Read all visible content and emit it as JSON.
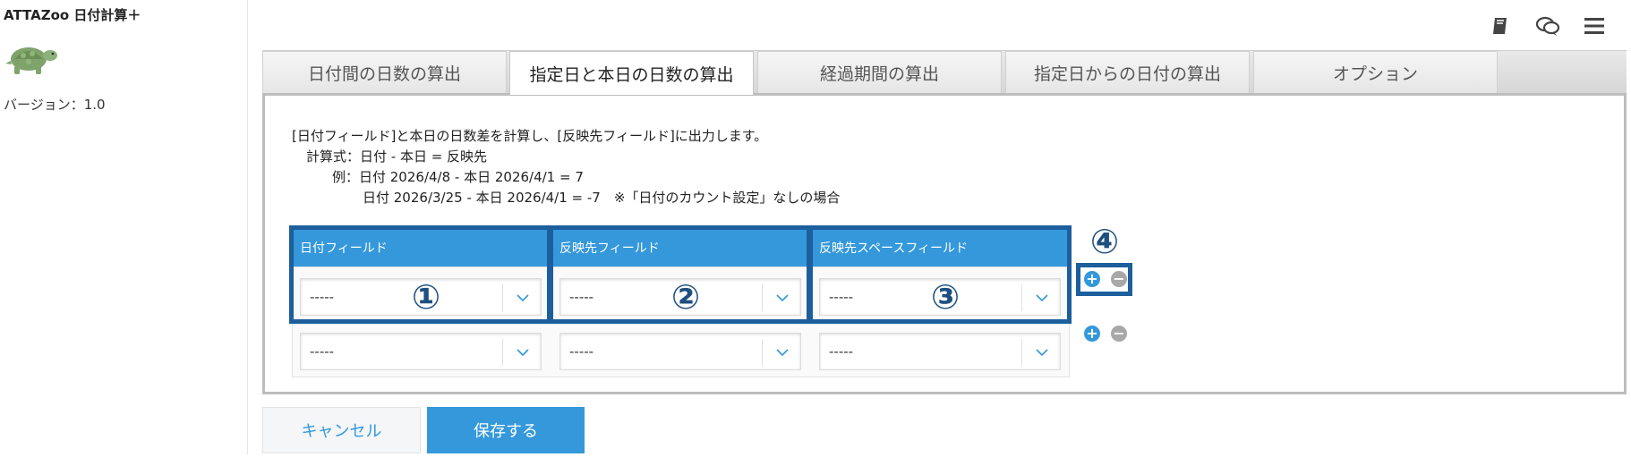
{
  "sidebar": {
    "app_title": "ATTAZoo 日付計算＋",
    "version": "バージョン：1.0"
  },
  "header_icons": [
    "manual-book-icon",
    "chat-bubbles-icon",
    "hamburger-menu-icon"
  ],
  "tabs": [
    {
      "label": "日付間の日数の算出",
      "active": false
    },
    {
      "label": "指定日と本日の日数の算出",
      "active": true
    },
    {
      "label": "経過期間の算出",
      "active": false
    },
    {
      "label": "指定日からの日付の算出",
      "active": false
    },
    {
      "label": "オプション",
      "active": false
    }
  ],
  "description": {
    "line1": "[日付フィールド]と本日の日数差を計算し、[反映先フィールド]に出力します。",
    "line2": "計算式：日付 - 本日 = 反映先",
    "line3": "例：日付 2026/4/8 - 本日 2026/4/1 = 7",
    "line4": "日付 2026/3/25 - 本日 2026/4/1 = -7　※「日付のカウント設定」なしの場合"
  },
  "table": {
    "headers": [
      "日付フィールド",
      "反映先フィールド",
      "反映先スペースフィールド"
    ],
    "rows": [
      [
        "-----",
        "-----",
        "-----"
      ],
      [
        "-----",
        "-----",
        "-----"
      ]
    ]
  },
  "annotations": [
    "①",
    "②",
    "③",
    "④"
  ],
  "buttons": {
    "cancel": "キャンセル",
    "save": "保存する"
  },
  "colors": {
    "accent": "#3498db",
    "annotation": "#1d5f9c"
  }
}
